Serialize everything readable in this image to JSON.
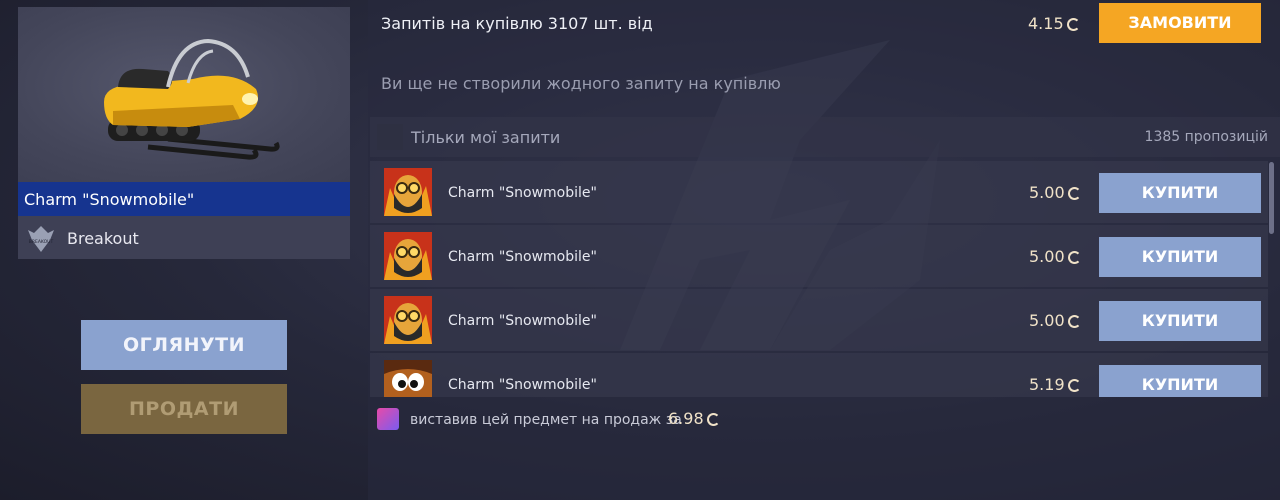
{
  "item": {
    "name": "Charm \"Snowmobile\"",
    "collection": "Breakout",
    "collection_icon_text": "BREAKOUT"
  },
  "actions": {
    "view_label": "ОГЛЯНУТИ",
    "sell_label": "ПРОДАТИ"
  },
  "buy_requests": {
    "title": "Запитів на купівлю 3107 шт. від",
    "price": "4.15",
    "order_label": "ЗАМОВИТИ",
    "empty_message": "Ви ще не створили жодного запиту на купівлю"
  },
  "filter": {
    "only_mine_label": "Тільки мої запити",
    "offers_count": "1385 пропозицій",
    "checked": false
  },
  "offers": [
    {
      "name": "Charm \"Snowmobile\"",
      "price": "5.00",
      "buy_label": "КУПИТИ",
      "avatar": "bearded-goggles-avatar"
    },
    {
      "name": "Charm \"Snowmobile\"",
      "price": "5.00",
      "buy_label": "КУПИТИ",
      "avatar": "bearded-goggles-avatar"
    },
    {
      "name": "Charm \"Snowmobile\"",
      "price": "5.00",
      "buy_label": "КУПИТИ",
      "avatar": "bearded-goggles-avatar"
    },
    {
      "name": "Charm \"Snowmobile\"",
      "price": "5.19",
      "buy_label": "КУПИТИ",
      "avatar": "cartoon-eyes-avatar"
    }
  ],
  "seller_note": {
    "text": "виставив цей предмет на продаж за",
    "price": "6.98"
  },
  "colors": {
    "accent_orange": "#f5a623",
    "button_blue": "#8aa2cf",
    "selected_blue": "#16348f",
    "gold_text": "#f0e2c8"
  }
}
